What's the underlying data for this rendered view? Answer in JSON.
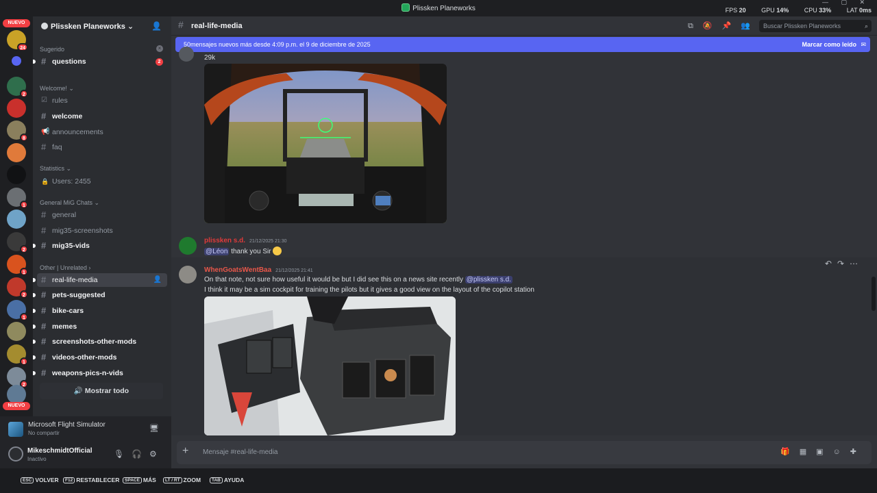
{
  "window": {
    "title": "Plissken Planeworks",
    "stats": [
      {
        "label": "FPS",
        "value": "20"
      },
      {
        "label": "GPU",
        "value": "14%"
      },
      {
        "label": "CPU",
        "value": "33%"
      },
      {
        "label": "LAT",
        "value": "0ms"
      }
    ],
    "controls": "— ▢ ✕"
  },
  "rail": {
    "new_label": "NUEVO",
    "top_badge": "24",
    "servers": [
      {
        "badge": "2",
        "color": "#2f6e4c"
      },
      {
        "badge": "",
        "color": "#c9302c"
      },
      {
        "badge": "8",
        "color": "#8a7f5d"
      },
      {
        "badge": "",
        "color": "#e07a3a"
      },
      {
        "badge": "",
        "color": "#111214"
      },
      {
        "badge": "1",
        "color": "#6b6f73"
      },
      {
        "badge": "",
        "color": "#6fa3c7"
      },
      {
        "badge": "2",
        "color": "#3a3a3a"
      },
      {
        "badge": "1",
        "color": "#d9531e"
      },
      {
        "badge": "2",
        "color": "#c0392b"
      },
      {
        "badge": "1",
        "color": "#4a6fa5"
      },
      {
        "badge": "",
        "color": "#8f8a5e"
      },
      {
        "badge": "1",
        "color": "#a48c2f"
      },
      {
        "badge": "2",
        "color": "#7d8b99"
      },
      {
        "badge": "",
        "color": "#5f7a94"
      }
    ]
  },
  "sidebar": {
    "server_name": "Plissken Planeworks",
    "categories": {
      "suggested": "Sugerido",
      "welcome": "Welcome!",
      "statistics": "Statistics",
      "general": "General MiG Chats",
      "other": "Other | Unrelated"
    },
    "channels": {
      "questions": {
        "label": "questions",
        "badge": "2"
      },
      "rules": "rules",
      "welcome": "welcome",
      "announcements": "announcements",
      "faq": "faq",
      "users": "Users: 2455",
      "general": "general",
      "mig35_screenshots": "mig35-screenshots",
      "mig35_vids": "mig35-vids",
      "real_life_media": "real-life-media",
      "pets_suggested": "pets-suggested",
      "bike_cars": "bike-cars",
      "memes": "memes",
      "screenshots_other_mods": "screenshots-other-mods",
      "videos_other_mods": "videos-other-mods",
      "weapons_pics_n_vids": "weapons-pics-n-vids"
    },
    "show_all": "Mostrar todo"
  },
  "activity": {
    "game": "Microsoft Flight Simulator",
    "sharing": "No compartir"
  },
  "user": {
    "name": "MikeschmidtOfficial",
    "status": "Inactivo"
  },
  "channel_header": {
    "name": "real-life-media",
    "search_placeholder": "Buscar Plissken Planeworks"
  },
  "new_messages_bar": {
    "text": "50mensajes nuevos más desde 4:09 p.m. el 9 de diciembre de 2025",
    "mark_read": "Marcar como leído"
  },
  "messages": [
    {
      "tail_text": "29k"
    },
    {
      "author": "plissken s.d.",
      "author_color": "#e03a3a",
      "timestamp": "21/12/2025 21:30",
      "mention": "@Léon",
      "text": "thank you Sir"
    },
    {
      "author": "WhenGoatsWentBaa",
      "author_color": "#e8574a",
      "timestamp": "21/12/2025 21:41",
      "line1": "On that note, not sure how useful it would be but I did see this on a news site recently",
      "line1_mention": "@plissken s.d.",
      "line2": "I think it may be a sim cockpit for training the pilots but it gives a good view on the layout of the copilot station"
    }
  ],
  "composer": {
    "placeholder": "Mensaje #real-life-media"
  },
  "hints": [
    {
      "key": "ESC",
      "label": "VOLVER"
    },
    {
      "key": "F12",
      "label": "RESTABLECER"
    },
    {
      "key": "SPACE",
      "label": "MÁS"
    },
    {
      "key": "LT / RT",
      "label": "ZOOM"
    },
    {
      "key": "TAB",
      "label": "AYUDA"
    }
  ]
}
